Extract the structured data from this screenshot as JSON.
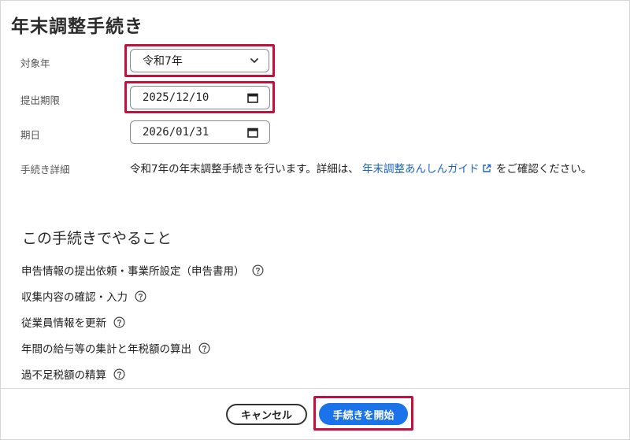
{
  "page": {
    "title": "年末調整手続き"
  },
  "form": {
    "year_label": "対象年",
    "year_value": "令和7年",
    "deadline_label": "提出期限",
    "deadline_value": "2025/12/10",
    "period_label": "期日",
    "period_value": "2026/01/31",
    "details_label": "手続き詳細",
    "details_text_before": "令和7年の年末調整手続きを行います。詳細は、",
    "details_link": "年末調整あんしんガイド",
    "details_text_after": "をご確認ください。"
  },
  "tasks": {
    "heading": "この手続きでやること",
    "items": [
      "申告情報の提出依頼・事業所設定（申告書用）",
      "収集内容の確認・入力",
      "従業員情報を更新",
      "年間の給与等の集計と年税額の算出",
      "過不足税額の精算"
    ]
  },
  "footer": {
    "cancel_label": "キャンセル",
    "start_label": "手続きを開始"
  },
  "colors": {
    "accent": "#1a73e8",
    "highlight": "#c3113f",
    "link": "#1a64c9"
  },
  "icons": {
    "select": "chevron-down-icon",
    "date": "calendar-icon",
    "link": "external-link-icon",
    "help": "help-circle-icon"
  }
}
